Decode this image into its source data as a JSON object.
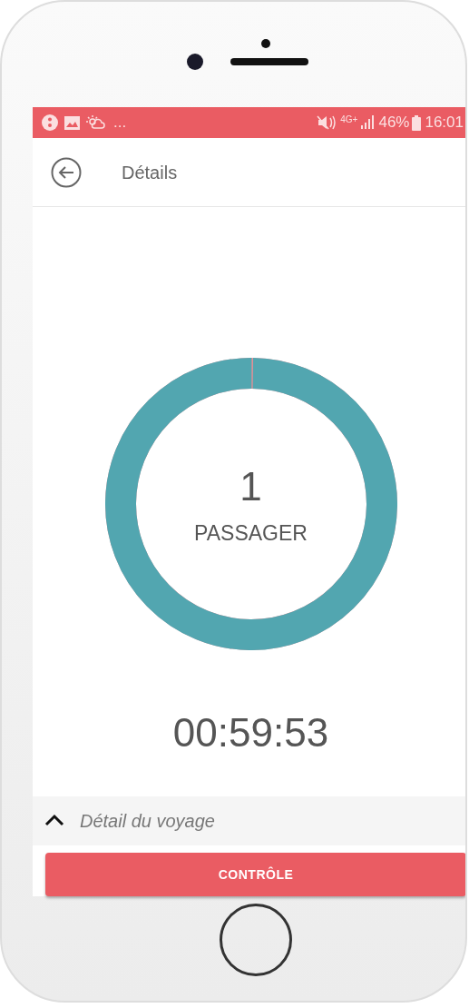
{
  "status_bar": {
    "left_text": "...",
    "network": "4G+",
    "battery": "46%",
    "time": "16:01"
  },
  "app_bar": {
    "title": "Détails"
  },
  "counter": {
    "count": "1",
    "label": "PASSAGER",
    "level": 0.998
  },
  "timer": "00:59:53",
  "trip_details": {
    "label": "Détail du voyage",
    "expanded": false
  },
  "control_button": "CONTRÔLE"
}
